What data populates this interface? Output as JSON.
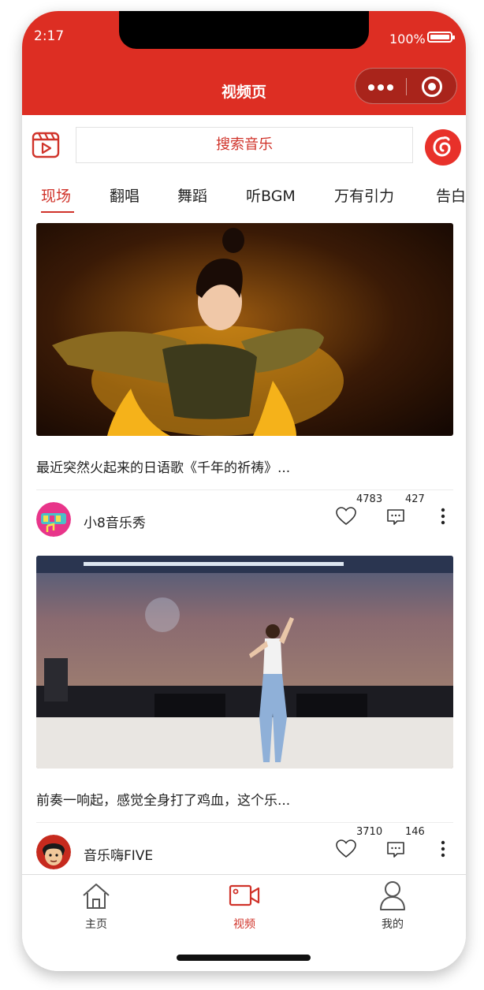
{
  "status_bar": {
    "time": "2:17",
    "battery_text": "100%",
    "battery_level": 1.0
  },
  "header": {
    "title": "视频页"
  },
  "search": {
    "placeholder": "搜索音乐"
  },
  "tabs": [
    {
      "label": "现场",
      "active": true
    },
    {
      "label": "翻唱",
      "active": false
    },
    {
      "label": "舞蹈",
      "active": false
    },
    {
      "label": "听BGM",
      "active": false
    },
    {
      "label": "万有引力",
      "active": false
    },
    {
      "label": "告白",
      "active": false
    }
  ],
  "videos": [
    {
      "title": "最近突然火起来的日语歌《千年的祈祷》...",
      "author": "小8音乐秀",
      "likes": "4783",
      "comments": "427"
    },
    {
      "title": "前奏一响起，感觉全身打了鸡血，这个乐...",
      "author": "音乐嗨FIVE",
      "likes": "3710",
      "comments": "146"
    }
  ],
  "tabbar": [
    {
      "label": "主页",
      "icon": "home-icon",
      "active": false
    },
    {
      "label": "视频",
      "icon": "video-camera-icon",
      "active": true
    },
    {
      "label": "我的",
      "icon": "person-icon",
      "active": false
    }
  ],
  "colors": {
    "brand": "#dd2e23",
    "accent": "#d0332a"
  }
}
